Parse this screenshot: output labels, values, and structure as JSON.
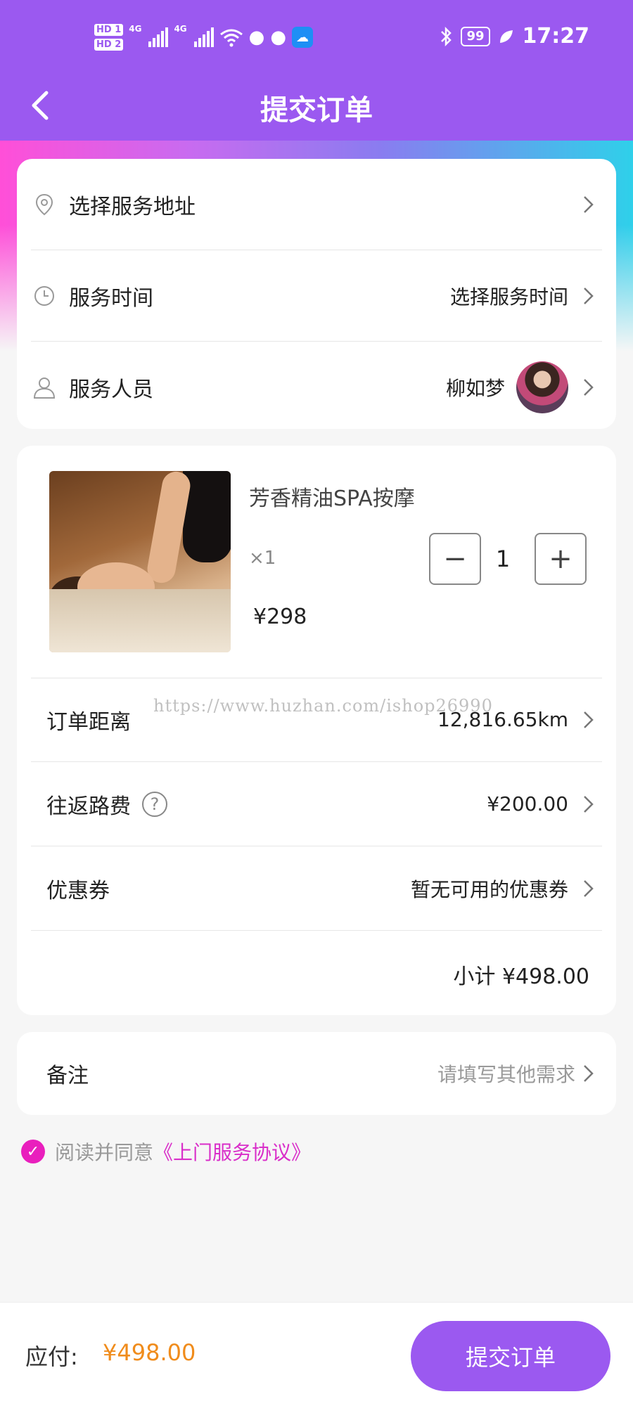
{
  "status_bar": {
    "hd1": "HD 1",
    "hd2": "HD 2",
    "net1": "4G",
    "net2": "4G",
    "battery": "99",
    "time": "17:27",
    "icons": [
      "wifi-icon",
      "wechat-icon",
      "wechat-icon",
      "weather-icon",
      "bluetooth-icon",
      "leaf-icon"
    ]
  },
  "header": {
    "title": "提交订单",
    "back_icon": "chevron-left-icon"
  },
  "info_card": {
    "address": {
      "label": "选择服务地址",
      "icon": "location-pin-icon"
    },
    "time": {
      "label": "服务时间",
      "value": "选择服务时间",
      "icon": "clock-icon"
    },
    "staff": {
      "label": "服务人员",
      "value": "柳如梦",
      "icon": "user-icon"
    }
  },
  "product": {
    "name": "芳香精油SPA按摩",
    "qty_label": "×1",
    "price": "¥298",
    "quantity": "1",
    "minus": "−",
    "plus": "+"
  },
  "details": {
    "distance": {
      "label": "订单距离",
      "value": "12,816.65km"
    },
    "travel_fee": {
      "label": "往返路费",
      "value": "¥200.00",
      "help": "?"
    },
    "coupon": {
      "label": "优惠券",
      "value": "暂无可用的优惠券"
    },
    "subtotal": "小计 ¥498.00"
  },
  "watermark": "https://www.huzhan.com/ishop26990",
  "note": {
    "label": "备注",
    "placeholder": "请填写其他需求"
  },
  "agreement": {
    "text": "阅读并同意",
    "link": "《上门服务协议》"
  },
  "footer": {
    "pay_label": "应付:",
    "pay_amount": "¥498.00",
    "submit": "提交订单"
  },
  "colors": {
    "brand": "#9b59f0",
    "price_accent": "#f08c1c",
    "link": "#d92ec9"
  }
}
